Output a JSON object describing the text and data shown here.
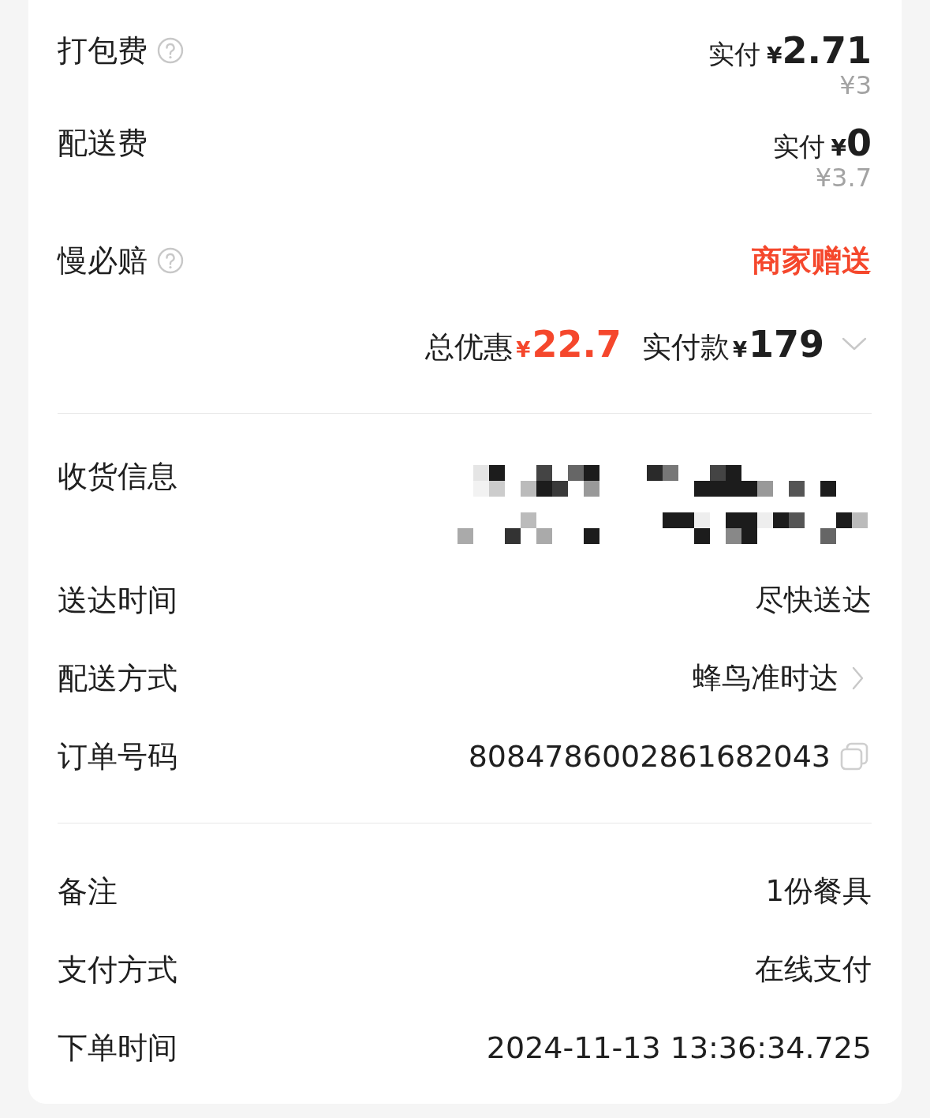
{
  "fees": [
    {
      "kind": "price",
      "label": "打包费",
      "help": true,
      "paid_label": "实付",
      "currency": "¥",
      "paid": "2.71",
      "original": "¥3"
    },
    {
      "kind": "price",
      "label": "配送费",
      "help": false,
      "paid_label": "实付",
      "currency": "¥",
      "paid": "0",
      "original": "¥3.7"
    },
    {
      "kind": "promo",
      "label": "慢必赔",
      "help": true,
      "value": "商家赠送"
    }
  ],
  "summary": {
    "discount_label": "总优惠",
    "discount_currency": "¥",
    "discount": "22.7",
    "total_label": "实付款",
    "total_currency": "¥",
    "total": "179",
    "expanded": false
  },
  "order_info": [
    {
      "kind": "redacted",
      "label": "收货信息"
    },
    {
      "kind": "text",
      "label": "送达时间",
      "value": "尽快送达"
    },
    {
      "kind": "link",
      "label": "配送方式",
      "value": "蜂鸟准时达"
    },
    {
      "kind": "copy",
      "label": "订单号码",
      "value": "8084786002861682043"
    }
  ],
  "extra_info": [
    {
      "kind": "text",
      "label": "备注",
      "value": "1份餐具"
    },
    {
      "kind": "text",
      "label": "支付方式",
      "value": "在线支付"
    },
    {
      "kind": "text",
      "label": "下单时间",
      "value": "2024-11-13 13:36:34.725"
    }
  ]
}
